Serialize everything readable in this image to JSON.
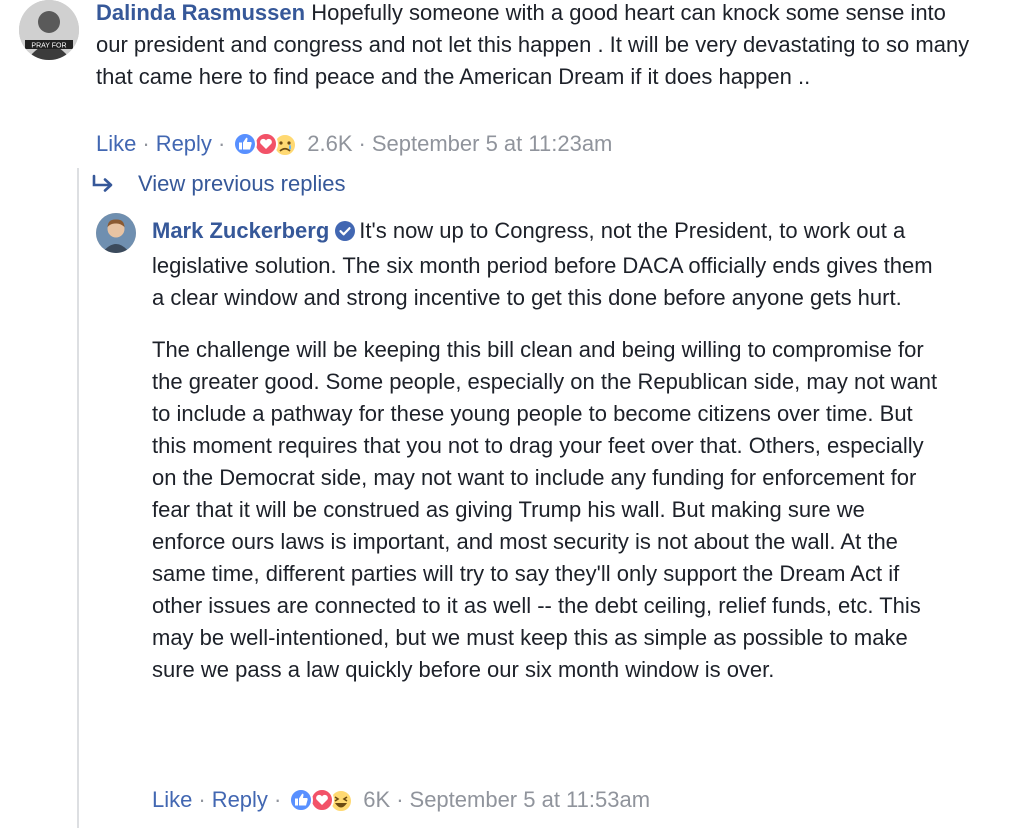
{
  "comment1": {
    "author": "Dalinda Rasmussen",
    "text": "Hopefully someone with a good heart can knock some sense into our president and congress and not let this happen . It will be very devastating to so many that came here to find peace and the American Dream if it does happen ..",
    "like_label": "Like",
    "reply_label": "Reply",
    "reaction_count": "2.6K",
    "timestamp": "September 5 at 11:23am",
    "reactions": [
      "like-icon",
      "love-icon",
      "sad-icon"
    ]
  },
  "view_previous": {
    "label": "View previous replies"
  },
  "comment2": {
    "author": "Mark Zuckerberg",
    "verified": true,
    "paragraph1": "It's now up to Congress, not the President, to work out a legislative solution. The six month period before DACA officially ends gives them a clear window and strong incentive to get this done before anyone gets hurt.",
    "paragraph2": "The challenge will be keeping this bill clean and being willing to compromise for the greater good. Some people, especially on the Republican side, may not want to include a pathway for these young people to become citizens over time. But this moment requires that you not to drag your feet over that. Others, especially on the Democrat side, may not want to include any funding for enforcement for fear that it will be construed as giving Trump his wall. But making sure we enforce ours laws is important, and most security is not about the wall. At the same time, different parties will try to say they'll only support the Dream Act if other issues are connected to it as well -- the debt ceiling, relief funds, etc. This may be well-intentioned, but we must keep this as simple as possible to make sure we pass a law quickly before our six month window is over.",
    "like_label": "Like",
    "reply_label": "Reply",
    "reaction_count": "6K",
    "timestamp": "September 5 at 11:53am",
    "reactions": [
      "like-icon",
      "love-icon",
      "haha-icon"
    ]
  },
  "colors": {
    "author": "#365899",
    "link": "#4267b2",
    "meta": "#90949c",
    "text": "#1d2129",
    "thread_line": "#dddfe2",
    "like": "#5890ff",
    "love": "#f25268",
    "reaction_yellow": "#ffd972"
  }
}
